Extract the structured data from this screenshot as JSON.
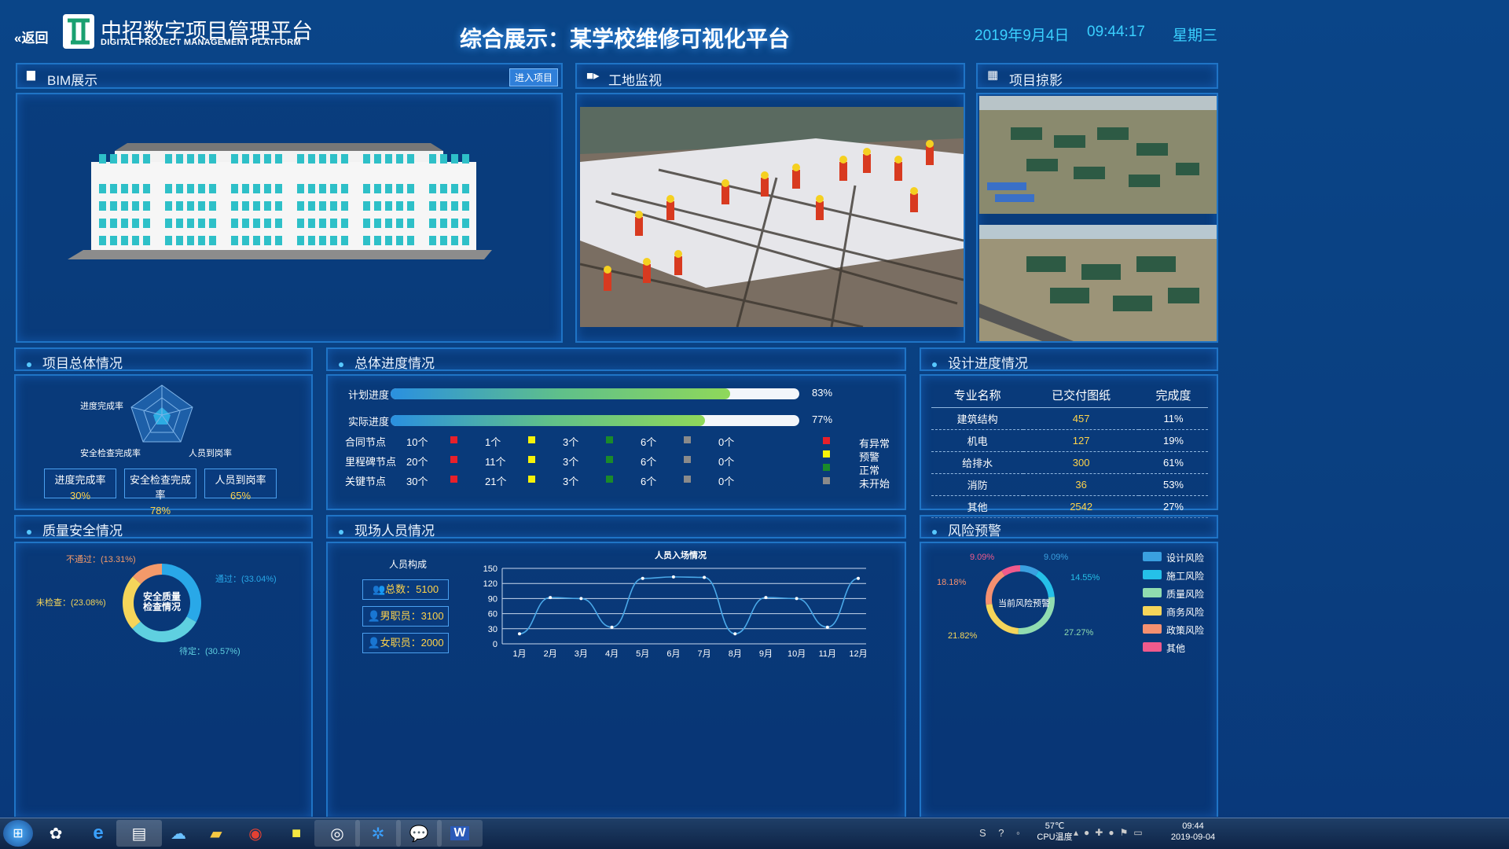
{
  "header": {
    "back_label": "返回",
    "logo_cn": "中招数字项目管理平台",
    "logo_en": "DIGITAL PROJECT MANAGEMENT PLATFORM",
    "title": "综合展示：某学校维修可视化平台",
    "date": "2019年9月4日",
    "time": "09:44:17",
    "weekday": "星期三"
  },
  "panels": {
    "bim": "BIM展示",
    "bim_btn": "进入项目",
    "monitor": "工地监视",
    "photo": "项目掠影",
    "overview": "项目总体情况",
    "progress": "总体进度情况",
    "design": "设计进度情况",
    "quality": "质量安全情况",
    "staff": "现场人员情况",
    "risk": "风险预警"
  },
  "overview": {
    "radar_labels": [
      "进度完成率",
      "安全检查完成率",
      "人员到岗率"
    ],
    "stats": [
      {
        "label": "进度完成率",
        "value": "30%"
      },
      {
        "label": "安全检查完成率",
        "value": "78%"
      },
      {
        "label": "人员到岗率",
        "value": "65%"
      }
    ]
  },
  "progress": {
    "bars": [
      {
        "label": "计划进度",
        "value": 83,
        "text": "83%"
      },
      {
        "label": "实际进度",
        "value": 77,
        "text": "77%"
      }
    ],
    "rows": [
      {
        "label": "合同节点",
        "total": "10个",
        "red": "1个",
        "yellow": "3个",
        "green": "6个",
        "grey": "0个"
      },
      {
        "label": "里程碑节点",
        "total": "20个",
        "red": "11个",
        "yellow": "3个",
        "green": "6个",
        "grey": "0个"
      },
      {
        "label": "关键节点",
        "total": "30个",
        "red": "21个",
        "yellow": "3个",
        "green": "6个",
        "grey": "0个"
      }
    ],
    "legend": [
      "有异常",
      "预警",
      "正常",
      "未开始"
    ],
    "colors": {
      "red": "#e8202a",
      "yellow": "#f5f20a",
      "green": "#1a8a2a",
      "grey": "#8a8a8a"
    }
  },
  "design": {
    "headers": [
      "专业名称",
      "已交付图纸",
      "完成度"
    ],
    "rows": [
      [
        "建筑结构",
        "457",
        "11%"
      ],
      [
        "机电",
        "127",
        "19%"
      ],
      [
        "给排水",
        "300",
        "61%"
      ],
      [
        "消防",
        "36",
        "53%"
      ],
      [
        "其他",
        "2542",
        "27%"
      ]
    ]
  },
  "quality": {
    "center": [
      "安全质量",
      "检查情况"
    ],
    "labels": {
      "fail": "不通过：(13.31%)",
      "pass": "通过：(33.04%)",
      "unchecked": "未检查：(23.08%)",
      "pending": "待定：(30.57%)"
    },
    "values": [
      33.04,
      30.57,
      23.08,
      13.31
    ],
    "colors": [
      "#29a8e8",
      "#5fd0e0",
      "#f5d55a",
      "#f39a6a"
    ]
  },
  "staff": {
    "composition_title": "人员构成",
    "items": [
      "总数：5100",
      "男职员：3100",
      "女职员：2000"
    ],
    "chart_data": {
      "type": "line",
      "title": "人员入场情况",
      "categories": [
        "1月",
        "2月",
        "3月",
        "4月",
        "5月",
        "6月",
        "7月",
        "8月",
        "9月",
        "10月",
        "11月",
        "12月"
      ],
      "values": [
        20,
        92,
        90,
        33,
        130,
        133,
        132,
        20,
        92,
        90,
        33,
        130
      ],
      "ylim": [
        0,
        150
      ],
      "yticks": [
        0,
        30,
        60,
        90,
        120,
        150
      ]
    }
  },
  "risk": {
    "center": "当前风险预警",
    "labels": [
      "9.09%",
      "9.09%",
      "14.55%",
      "27.27%",
      "21.82%",
      "18.18%"
    ],
    "legend": [
      "设计风险",
      "施工风险",
      "质量风险",
      "商务风险",
      "政策风险",
      "其他"
    ],
    "colors": [
      "#3aa0e0",
      "#25c0e8",
      "#90dcb0",
      "#f5d55a",
      "#f59070",
      "#f05a8c"
    ],
    "chart_data": {
      "type": "pie",
      "categories": [
        "设计风险",
        "施工风险",
        "质量风险",
        "商务风险",
        "政策风险",
        "其他"
      ],
      "values": [
        9.09,
        14.55,
        27.27,
        21.82,
        18.18,
        9.09
      ]
    }
  },
  "taskbar": {
    "temp": "57℃",
    "temp_label": "CPU温度",
    "clock": "09:44",
    "date": "2019-09-04"
  }
}
